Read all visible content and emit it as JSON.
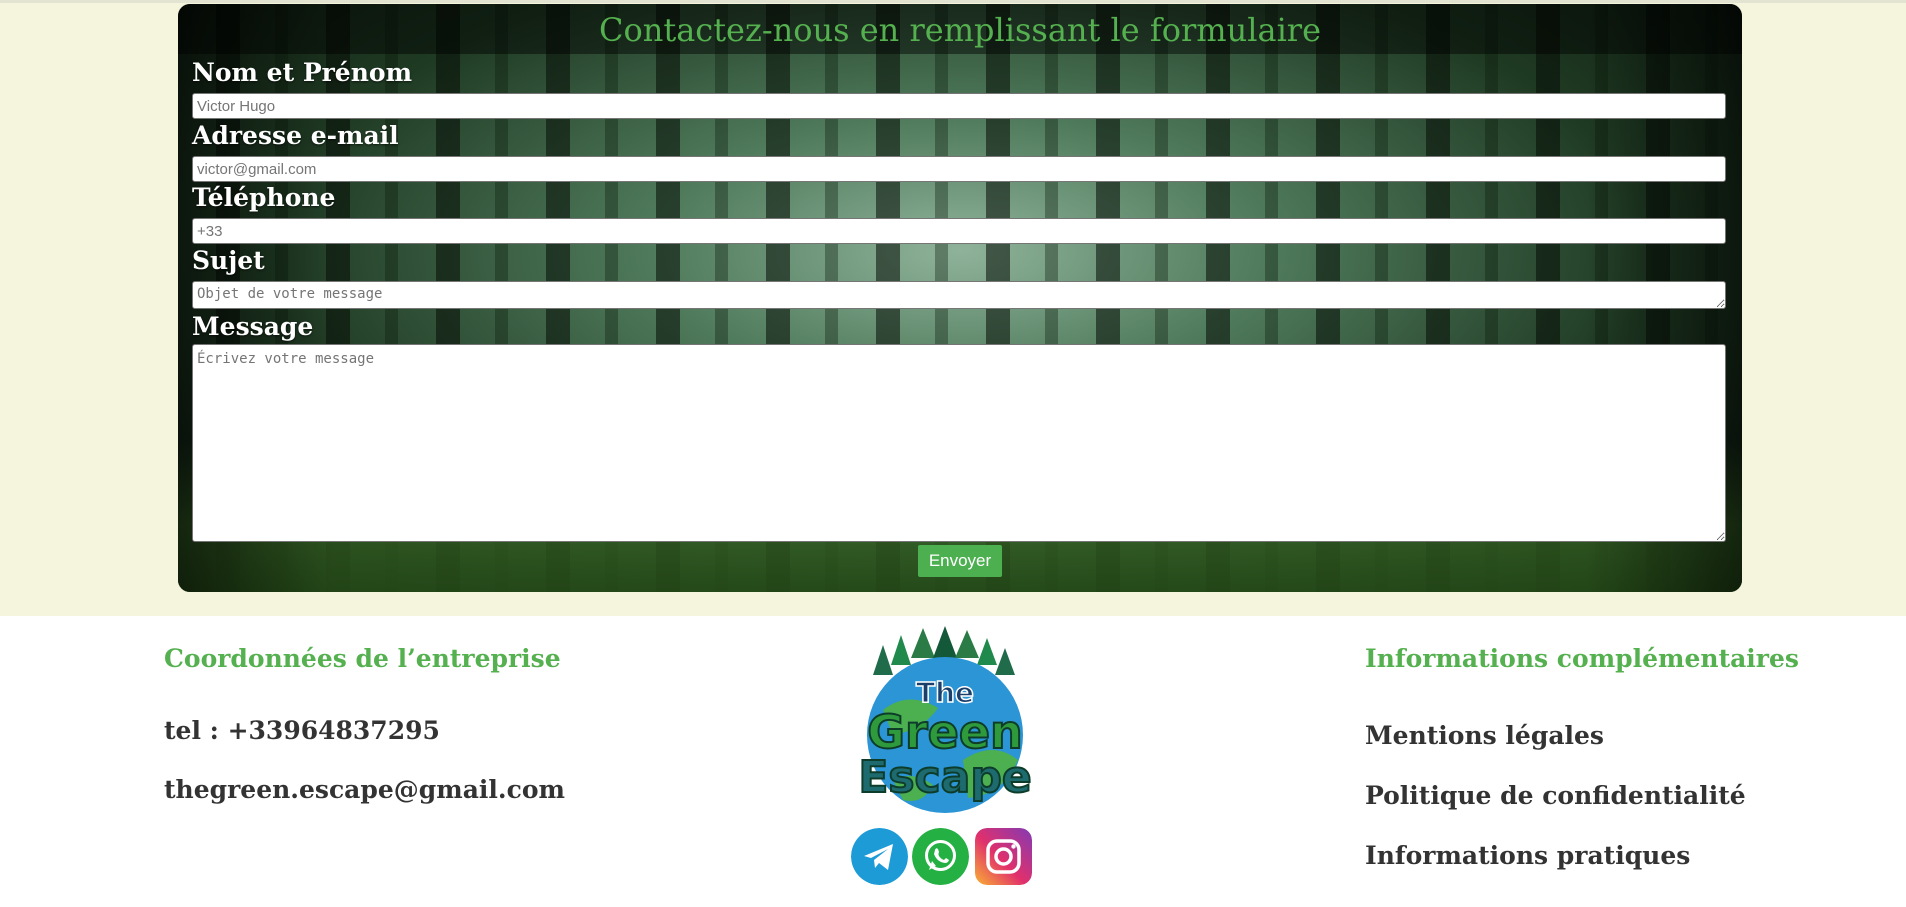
{
  "form": {
    "title": "Contactez-nous en remplissant le formulaire",
    "fields": {
      "name": {
        "label": "Nom et Prénom",
        "placeholder": "Victor Hugo"
      },
      "email": {
        "label": "Adresse e-mail",
        "placeholder": "victor@gmail.com"
      },
      "phone": {
        "label": "Téléphone",
        "placeholder": "+33"
      },
      "subject": {
        "label": "Sujet",
        "placeholder": "Objet de votre message"
      },
      "message": {
        "label": "Message",
        "placeholder": "Écrivez votre message"
      }
    },
    "submit_label": "Envoyer"
  },
  "footer": {
    "company": {
      "title": "Coordonnées de l’entreprise",
      "phone": "tel : +33964837295",
      "email": "thegreen.escape@gmail.com"
    },
    "logo": {
      "line1": "The",
      "line2": "Green",
      "line3": "Escape"
    },
    "social": [
      {
        "name": "telegram-icon",
        "color": "#1d9bd7"
      },
      {
        "name": "whatsapp-icon",
        "color": "#25b043"
      },
      {
        "name": "instagram-icon",
        "color": "#e1306c"
      }
    ],
    "info": {
      "title": "Informations complémentaires",
      "links": [
        "Mentions légales",
        "Politique de confidentialité",
        "Informations pratiques"
      ]
    }
  },
  "colors": {
    "accent": "#55b04f",
    "page_bg": "#f4f5dc",
    "button": "#4caf50"
  }
}
